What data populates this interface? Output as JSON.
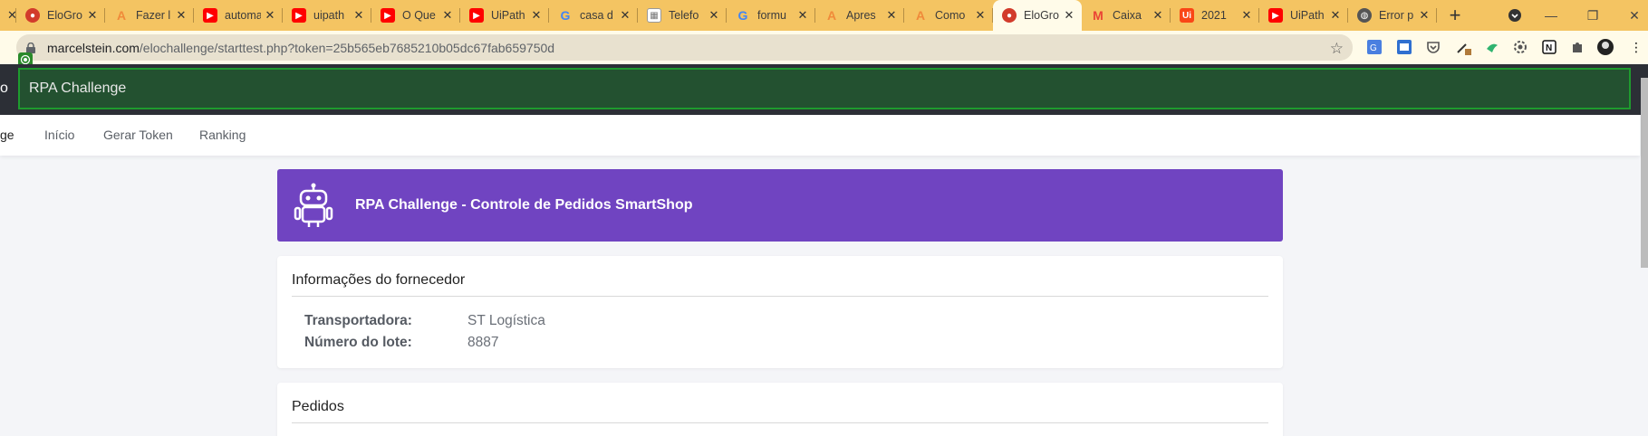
{
  "browser": {
    "tabs": [
      {
        "title": "EloGro",
        "icon": "elogroup-icon",
        "color": "#d23b2b"
      },
      {
        "title": "Fazer l",
        "icon": "a-icon",
        "color": "#f08a3a"
      },
      {
        "title": "automa",
        "icon": "youtube-icon",
        "color": "#ff0000"
      },
      {
        "title": "uipath",
        "icon": "youtube-icon",
        "color": "#ff0000"
      },
      {
        "title": "O Que",
        "icon": "youtube-icon",
        "color": "#ff0000"
      },
      {
        "title": "UiPath",
        "icon": "youtube-icon",
        "color": "#ff0000"
      },
      {
        "title": "casa d",
        "icon": "google-icon",
        "color": "#4285f4"
      },
      {
        "title": "Telefo",
        "icon": "calendar-icon",
        "color": "#777777"
      },
      {
        "title": "formu",
        "icon": "google-icon",
        "color": "#4285f4"
      },
      {
        "title": "Apres",
        "icon": "a-icon",
        "color": "#f08a3a"
      },
      {
        "title": "Como",
        "icon": "a-icon",
        "color": "#f08a3a"
      },
      {
        "title": "EloGro",
        "icon": "elogroup-icon",
        "color": "#d23b2b",
        "active": true
      },
      {
        "title": "Caixa",
        "icon": "gmail-icon",
        "color": "#ea4335"
      },
      {
        "title": "2021",
        "icon": "uipath-icon",
        "color": "#fa4616"
      },
      {
        "title": "UiPath",
        "icon": "youtube-icon",
        "color": "#ff0000"
      },
      {
        "title": "Error p",
        "icon": "globe-icon",
        "color": "#555555"
      }
    ],
    "url_host": "marcelstein.com",
    "url_path": "/elochallenge/starttest.php?token=25b565eb7685210b05dc67fab659750d"
  },
  "app": {
    "brand_fragment": "o",
    "title": "RPA Challenge",
    "nav_fragment": "ge",
    "nav": [
      "Início",
      "Gerar Token",
      "Ranking"
    ]
  },
  "banner": {
    "title": "RPA Challenge - Controle de Pedidos SmartShop"
  },
  "supplier": {
    "header": "Informações do fornecedor",
    "carrier_label": "Transportadora:",
    "carrier_value": "ST Logística",
    "lot_label": "Número do lote:",
    "lot_value": "8887"
  },
  "orders": {
    "header": "Pedidos"
  }
}
